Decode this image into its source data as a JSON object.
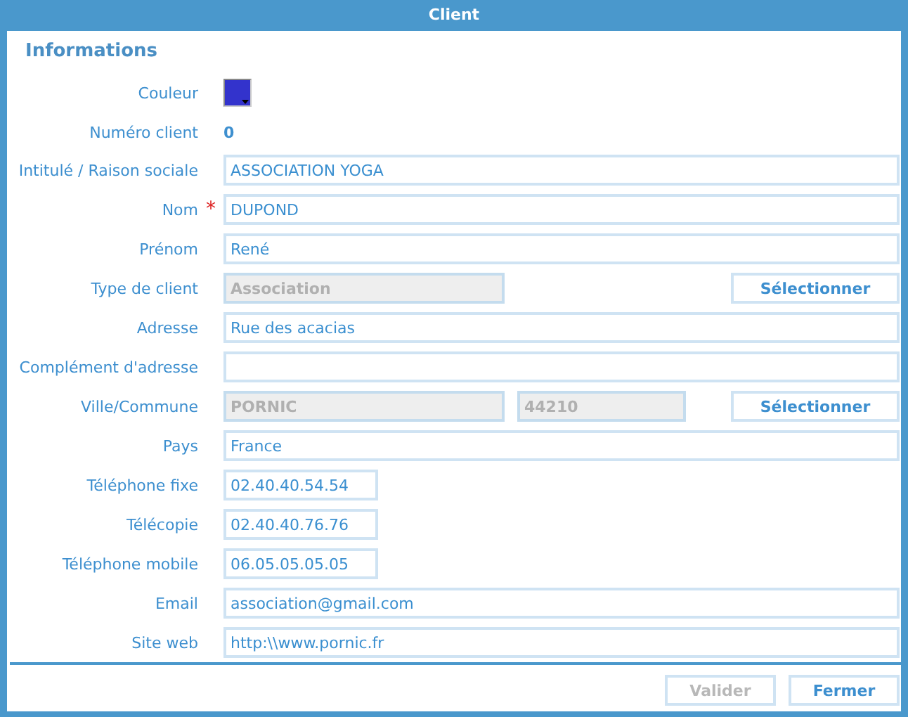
{
  "window": {
    "title": "Client"
  },
  "section": "Informations",
  "rows": [
    {
      "kind": "color",
      "label": "Couleur",
      "color": "#3333cc"
    },
    {
      "kind": "text",
      "label": "Numéro client",
      "value": "0"
    },
    {
      "kind": "field",
      "label": "Intitulé / Raison sociale",
      "fields": [
        {
          "value": "ASSOCIATION YOGA",
          "disabled": false,
          "kind": "wide"
        }
      ]
    },
    {
      "kind": "field",
      "label": "Nom",
      "required_mark": "*",
      "fields": [
        {
          "value": "DUPOND",
          "disabled": false,
          "kind": "wide"
        }
      ]
    },
    {
      "kind": "field",
      "label": "Prénom",
      "fields": [
        {
          "value": "René",
          "disabled": false,
          "kind": "wide"
        }
      ]
    },
    {
      "kind": "field",
      "label": "Type de client",
      "fields": [
        {
          "value": "Association",
          "disabled": true,
          "kind": "half"
        }
      ],
      "button": "Sélectionner"
    },
    {
      "kind": "field",
      "label": "Adresse",
      "fields": [
        {
          "value": "Rue des acacias",
          "disabled": false,
          "kind": "wide"
        }
      ]
    },
    {
      "kind": "field",
      "label": "Complément d'adresse",
      "fields": [
        {
          "disabled": false,
          "kind": "wide"
        }
      ]
    },
    {
      "kind": "field",
      "label": "Ville/Commune",
      "fields": [
        {
          "value": "PORNIC",
          "disabled": true,
          "kind": "half"
        },
        {
          "value": "44210",
          "disabled": true,
          "kind": "postal"
        }
      ],
      "button": "Sélectionner"
    },
    {
      "kind": "field",
      "label": "Pays",
      "fields": [
        {
          "value": "France",
          "disabled": false,
          "kind": "wide"
        }
      ]
    },
    {
      "kind": "field",
      "label": "Téléphone fixe",
      "fields": [
        {
          "value": "02.40.40.54.54",
          "disabled": false,
          "kind": "short"
        }
      ]
    },
    {
      "kind": "field",
      "label": "Télécopie",
      "fields": [
        {
          "value": "02.40.40.76.76",
          "disabled": false,
          "kind": "short"
        }
      ]
    },
    {
      "kind": "field",
      "label": "Téléphone mobile",
      "fields": [
        {
          "value": "06.05.05.05.05",
          "disabled": false,
          "kind": "short"
        }
      ]
    },
    {
      "kind": "field",
      "label": "Email",
      "fields": [
        {
          "value": "association@gmail.com",
          "disabled": false,
          "kind": "wide"
        }
      ]
    },
    {
      "kind": "field",
      "label": "Site web",
      "fields": [
        {
          "value": "http:\\\\www.pornic.fr",
          "disabled": false,
          "kind": "wide"
        }
      ]
    }
  ],
  "buttons": [
    {
      "label": "Valider",
      "disabled": true
    },
    {
      "label": "Fermer",
      "disabled": false
    }
  ]
}
